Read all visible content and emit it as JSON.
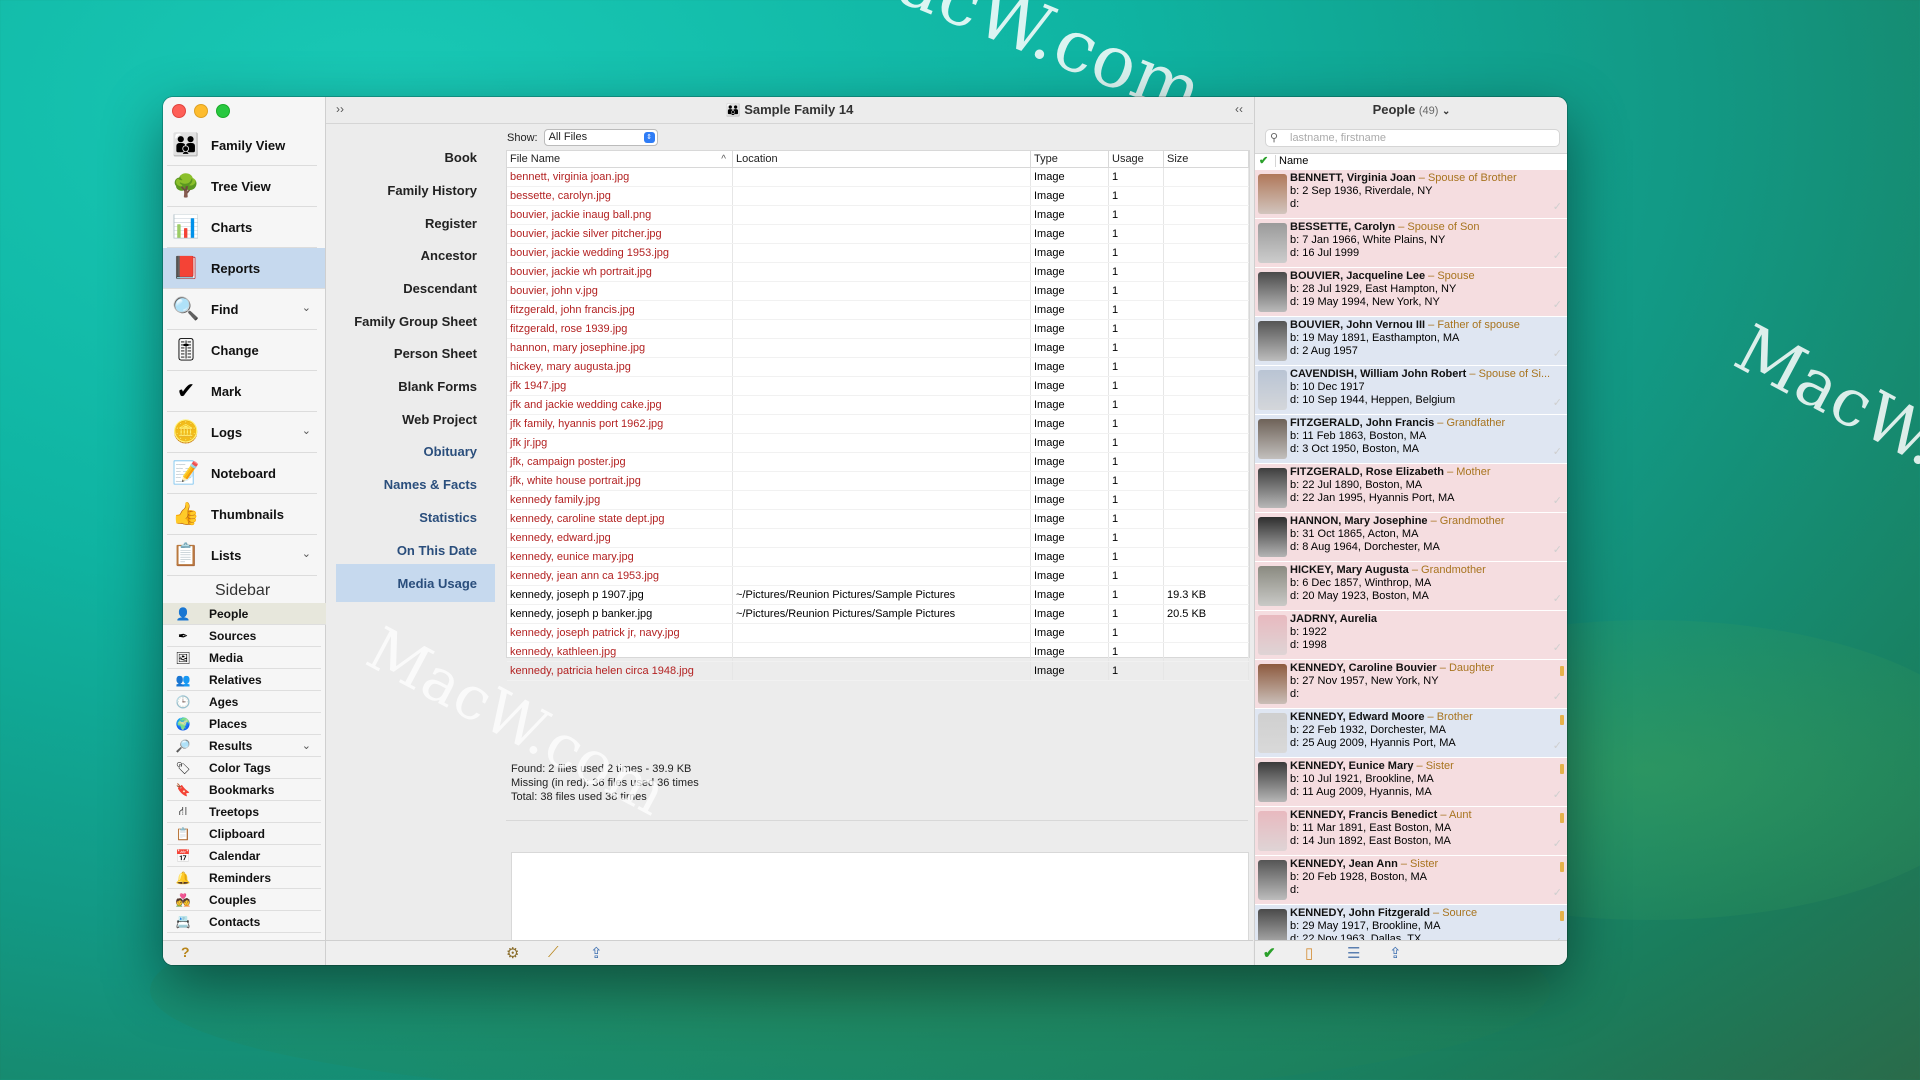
{
  "window": {
    "title": "Sample Family 14"
  },
  "nav": [
    {
      "label": "Family View",
      "icon": "family-view-icon",
      "glyph": "👪",
      "chevron": false
    },
    {
      "label": "Tree View",
      "icon": "tree-icon",
      "glyph": "🌳",
      "chevron": false
    },
    {
      "label": "Charts",
      "icon": "charts-icon",
      "glyph": "📊",
      "chevron": false
    },
    {
      "label": "Reports",
      "icon": "reports-icon",
      "glyph": "📕",
      "chevron": false,
      "active": true
    },
    {
      "label": "Find",
      "icon": "magnifier-icon",
      "glyph": "🔍",
      "chevron": true
    },
    {
      "label": "Change",
      "icon": "sliders-icon",
      "glyph": "🎚",
      "chevron": false
    },
    {
      "label": "Mark",
      "icon": "checkmark-icon",
      "glyph": "✔",
      "chevron": false
    },
    {
      "label": "Logs",
      "icon": "logs-icon",
      "glyph": "🪙",
      "chevron": true
    },
    {
      "label": "Noteboard",
      "icon": "noteboard-icon",
      "glyph": "📝",
      "chevron": false
    },
    {
      "label": "Thumbnails",
      "icon": "thumb-icon",
      "glyph": "👍",
      "chevron": false
    },
    {
      "label": "Lists",
      "icon": "lists-icon",
      "glyph": "📋",
      "chevron": true
    }
  ],
  "sidebar": {
    "header": "Sidebar",
    "items": [
      {
        "label": "People",
        "icon": "people-icon",
        "glyph": "👤",
        "active": true
      },
      {
        "label": "Sources",
        "icon": "sources-icon",
        "glyph": "✒"
      },
      {
        "label": "Media",
        "icon": "media-icon",
        "glyph": "🖼"
      },
      {
        "label": "Relatives",
        "icon": "relatives-icon",
        "glyph": "👥"
      },
      {
        "label": "Ages",
        "icon": "clock-icon",
        "glyph": "🕒"
      },
      {
        "label": "Places",
        "icon": "globe-icon",
        "glyph": "🌍"
      },
      {
        "label": "Results",
        "icon": "search-icon",
        "glyph": "🔎",
        "chevron": true
      },
      {
        "label": "Color Tags",
        "icon": "color-tag-icon",
        "glyph": "🏷"
      },
      {
        "label": "Bookmarks",
        "icon": "bookmark-icon",
        "glyph": "🔖"
      },
      {
        "label": "Treetops",
        "icon": "treetops-icon",
        "glyph": "⛙"
      },
      {
        "label": "Clipboard",
        "icon": "clipboard-icon",
        "glyph": "📋"
      },
      {
        "label": "Calendar",
        "icon": "calendar-icon",
        "glyph": "📅"
      },
      {
        "label": "Reminders",
        "icon": "bell-icon",
        "glyph": "🔔"
      },
      {
        "label": "Couples",
        "icon": "couples-icon",
        "glyph": "💑"
      },
      {
        "label": "Contacts",
        "icon": "contacts-icon",
        "glyph": "📇"
      }
    ]
  },
  "reports": [
    {
      "label": "Book"
    },
    {
      "label": "Family History"
    },
    {
      "label": "Register"
    },
    {
      "label": "Ancestor"
    },
    {
      "label": "Descendant"
    },
    {
      "label": "Family Group Sheet"
    },
    {
      "label": "Person Sheet"
    },
    {
      "label": "Blank Forms"
    },
    {
      "label": "Web Project"
    },
    {
      "label": "Obituary",
      "blue": true
    },
    {
      "label": "Names & Facts",
      "blue": true
    },
    {
      "label": "Statistics",
      "blue": true
    },
    {
      "label": "On This Date",
      "blue": true
    },
    {
      "label": "Media Usage",
      "blue": true,
      "active": true
    }
  ],
  "main": {
    "show_label": "Show:",
    "show_value": "All Files",
    "columns": [
      "File Name",
      "Location",
      "Type",
      "Usage",
      "Size"
    ],
    "rows": [
      {
        "name": "bennett, virginia joan.jpg",
        "loc": "",
        "type": "Image",
        "usage": "1",
        "size": "",
        "missing": true
      },
      {
        "name": "bessette, carolyn.jpg",
        "loc": "",
        "type": "Image",
        "usage": "1",
        "size": "",
        "missing": true
      },
      {
        "name": "bouvier, jackie inaug ball.png",
        "loc": "",
        "type": "Image",
        "usage": "1",
        "size": "",
        "missing": true
      },
      {
        "name": "bouvier, jackie silver pitcher.jpg",
        "loc": "",
        "type": "Image",
        "usage": "1",
        "size": "",
        "missing": true
      },
      {
        "name": "bouvier, jackie wedding 1953.jpg",
        "loc": "",
        "type": "Image",
        "usage": "1",
        "size": "",
        "missing": true
      },
      {
        "name": "bouvier, jackie wh portrait.jpg",
        "loc": "",
        "type": "Image",
        "usage": "1",
        "size": "",
        "missing": true
      },
      {
        "name": "bouvier, john v.jpg",
        "loc": "",
        "type": "Image",
        "usage": "1",
        "size": "",
        "missing": true
      },
      {
        "name": "fitzgerald, john francis.jpg",
        "loc": "",
        "type": "Image",
        "usage": "1",
        "size": "",
        "missing": true
      },
      {
        "name": "fitzgerald, rose 1939.jpg",
        "loc": "",
        "type": "Image",
        "usage": "1",
        "size": "",
        "missing": true
      },
      {
        "name": "hannon, mary josephine.jpg",
        "loc": "",
        "type": "Image",
        "usage": "1",
        "size": "",
        "missing": true
      },
      {
        "name": "hickey, mary augusta.jpg",
        "loc": "",
        "type": "Image",
        "usage": "1",
        "size": "",
        "missing": true
      },
      {
        "name": "jfk 1947.jpg",
        "loc": "",
        "type": "Image",
        "usage": "1",
        "size": "",
        "missing": true
      },
      {
        "name": "jfk and jackie wedding cake.jpg",
        "loc": "",
        "type": "Image",
        "usage": "1",
        "size": "",
        "missing": true
      },
      {
        "name": "jfk family, hyannis port 1962.jpg",
        "loc": "",
        "type": "Image",
        "usage": "1",
        "size": "",
        "missing": true
      },
      {
        "name": "jfk jr.jpg",
        "loc": "",
        "type": "Image",
        "usage": "1",
        "size": "",
        "missing": true
      },
      {
        "name": "jfk, campaign poster.jpg",
        "loc": "",
        "type": "Image",
        "usage": "1",
        "size": "",
        "missing": true
      },
      {
        "name": "jfk, white house portrait.jpg",
        "loc": "",
        "type": "Image",
        "usage": "1",
        "size": "",
        "missing": true
      },
      {
        "name": "kennedy family.jpg",
        "loc": "",
        "type": "Image",
        "usage": "1",
        "size": "",
        "missing": true
      },
      {
        "name": "kennedy, caroline state dept.jpg",
        "loc": "",
        "type": "Image",
        "usage": "1",
        "size": "",
        "missing": true
      },
      {
        "name": "kennedy, edward.jpg",
        "loc": "",
        "type": "Image",
        "usage": "1",
        "size": "",
        "missing": true
      },
      {
        "name": "kennedy, eunice mary.jpg",
        "loc": "",
        "type": "Image",
        "usage": "1",
        "size": "",
        "missing": true
      },
      {
        "name": "kennedy, jean ann ca 1953.jpg",
        "loc": "",
        "type": "Image",
        "usage": "1",
        "size": "",
        "missing": true
      },
      {
        "name": "kennedy, joseph p 1907.jpg",
        "loc": "~/Pictures/Reunion Pictures/Sample Pictures",
        "type": "Image",
        "usage": "1",
        "size": "19.3 KB",
        "missing": false
      },
      {
        "name": "kennedy, joseph p banker.jpg",
        "loc": "~/Pictures/Reunion Pictures/Sample Pictures",
        "type": "Image",
        "usage": "1",
        "size": "20.5 KB",
        "missing": false
      },
      {
        "name": "kennedy, joseph patrick jr, navy.jpg",
        "loc": "",
        "type": "Image",
        "usage": "1",
        "size": "",
        "missing": true
      },
      {
        "name": "kennedy, kathleen.jpg",
        "loc": "",
        "type": "Image",
        "usage": "1",
        "size": "",
        "missing": true
      },
      {
        "name": "kennedy, patricia helen circa 1948.jpg",
        "loc": "",
        "type": "Image",
        "usage": "1",
        "size": "",
        "missing": true
      }
    ],
    "summary": {
      "found": "Found: 2 files used 2 times - 39.9 KB",
      "missing": "Missing (in red): 36 files used 36 times",
      "total": "Total: 38 files used 38 times"
    }
  },
  "people_pane": {
    "title": "People",
    "count": "(49)",
    "search_placeholder": "lastname, firstname",
    "col_name": "Name",
    "people": [
      {
        "name": "BENNETT, Virginia Joan",
        "rel": "– Spouse of Brother",
        "b": "b: 2 Sep 1936, Riverdale, NY",
        "d": "d:",
        "sex": "f",
        "mark": false,
        "avatar": "#b0785a"
      },
      {
        "name": "BESSETTE, Carolyn",
        "rel": "– Spouse of Son",
        "b": "b: 7 Jan 1966, White Plains, NY",
        "d": "d: 16 Jul 1999",
        "sex": "f",
        "mark": false,
        "avatar": "#9a9a9a"
      },
      {
        "name": "BOUVIER, Jacqueline Lee",
        "rel": "– Spouse",
        "b": "b: 28 Jul 1929, East Hampton, NY",
        "d": "d: 19 May 1994, New York, NY",
        "sex": "f",
        "mark": false,
        "avatar": "#4a4a4a"
      },
      {
        "name": "BOUVIER, John Vernou III",
        "rel": "– Father of spouse",
        "b": "b: 19 May 1891, Easthampton, MA",
        "d": "d: 2 Aug 1957",
        "sex": "m",
        "mark": false,
        "avatar": "#555555"
      },
      {
        "name": "CAVENDISH, William John Robert",
        "rel": "– Spouse of Si...",
        "b": "b: 10 Dec 1917",
        "d": "d: 10 Sep 1944, Heppen, Belgium",
        "sex": "m",
        "mark": false,
        "avatar": "#b9c4d4"
      },
      {
        "name": "FITZGERALD, John Francis",
        "rel": "– Grandfather",
        "b": "b: 11 Feb 1863, Boston, MA",
        "d": "d: 3 Oct 1950, Boston, MA",
        "sex": "m",
        "mark": false,
        "avatar": "#6e6258"
      },
      {
        "name": "FITZGERALD, Rose Elizabeth",
        "rel": "– Mother",
        "b": "b: 22 Jul 1890, Boston, MA",
        "d": "d: 22 Jan 1995, Hyannis Port, MA",
        "sex": "f",
        "mark": false,
        "avatar": "#3e3e3e"
      },
      {
        "name": "HANNON, Mary Josephine",
        "rel": "– Grandmother",
        "b": "b: 31 Oct 1865, Acton, MA",
        "d": "d: 8 Aug 1964, Dorchester, MA",
        "sex": "f",
        "mark": false,
        "avatar": "#2e2e2e"
      },
      {
        "name": "HICKEY, Mary Augusta",
        "rel": "– Grandmother",
        "b": "b: 6 Dec 1857, Winthrop, MA",
        "d": "d: 20 May 1923, Boston, MA",
        "sex": "f",
        "mark": false,
        "avatar": "#8a8a80"
      },
      {
        "name": "JADRNY, Aurelia",
        "rel": "",
        "b": "b: 1922",
        "d": "d: 1998",
        "sex": "f",
        "mark": false,
        "avatar": "#e8b9bf"
      },
      {
        "name": "KENNEDY, Caroline Bouvier",
        "rel": "– Daughter",
        "b": "b: 27 Nov 1957, New York, NY",
        "d": "d:",
        "sex": "f",
        "mark": true,
        "avatar": "#8d5a3e"
      },
      {
        "name": "KENNEDY, Edward Moore",
        "rel": "– Brother",
        "b": "b: 22 Feb 1932, Dorchester, MA",
        "d": "d: 25 Aug 2009, Hyannis Port, MA",
        "sex": "m",
        "mark": true,
        "avatar": "#cfcfcf"
      },
      {
        "name": "KENNEDY, Eunice Mary",
        "rel": "– Sister",
        "b": "b: 10 Jul 1921, Brookline, MA",
        "d": "d: 11 Aug 2009, Hyannis, MA",
        "sex": "f",
        "mark": true,
        "avatar": "#3a3a3a"
      },
      {
        "name": "KENNEDY, Francis Benedict",
        "rel": "– Aunt",
        "b": "b: 11 Mar 1891, East Boston, MA",
        "d": "d: 14 Jun 1892, East Boston, MA",
        "sex": "f",
        "mark": true,
        "avatar": "#e8b9bf"
      },
      {
        "name": "KENNEDY, Jean Ann",
        "rel": "– Sister",
        "b": "b: 20 Feb 1928, Boston, MA",
        "d": "d:",
        "sex": "f",
        "mark": true,
        "avatar": "#555555"
      },
      {
        "name": "KENNEDY, John Fitzgerald",
        "rel": "– Source",
        "b": "b: 29 May 1917, Brookline, MA",
        "d": "d: 22 Nov 1963, Dallas, TX",
        "sex": "m",
        "mark": true,
        "avatar": "#4a4a4a"
      }
    ]
  },
  "watermark": "MacW.com"
}
